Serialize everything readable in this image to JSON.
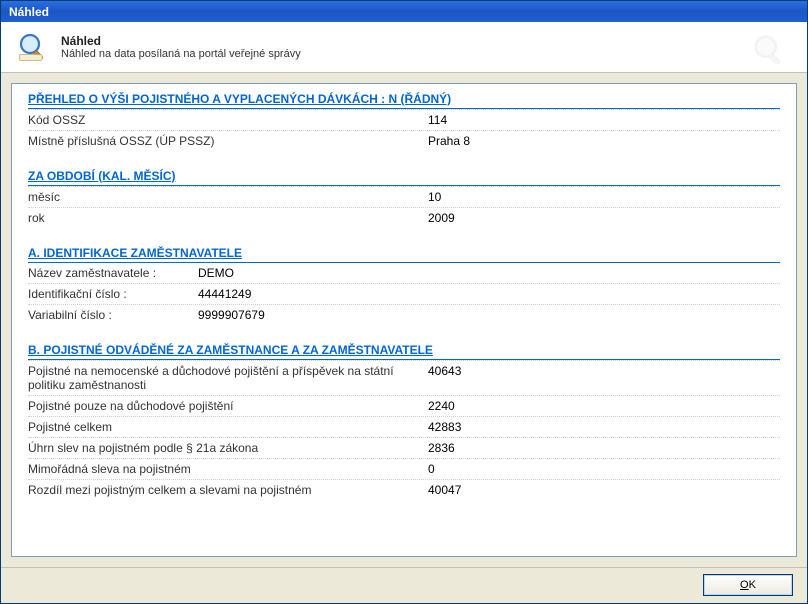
{
  "window": {
    "title": "Náhled"
  },
  "header": {
    "title": "Náhled",
    "subtitle": "Náhled na data posílaná na portál veřejné správy"
  },
  "sections": {
    "overview": {
      "heading": "PŘEHLED O VÝŠI POJISTNÉHO A VYPLACENÝCH DÁVKÁCH : N (ŘÁDNÝ)",
      "rows": [
        {
          "label": "Kód OSSZ",
          "value": "114"
        },
        {
          "label": "Místně příslušná OSSZ (ÚP PSSZ)",
          "value": "Praha 8"
        }
      ]
    },
    "period": {
      "heading": "ZA OBDOBÍ (KAL. MĚSÍC)",
      "rows": [
        {
          "label": "měsíc",
          "value": "10"
        },
        {
          "label": "rok",
          "value": "2009"
        }
      ]
    },
    "employer": {
      "heading": "A. IDENTIFIKACE ZAMĚSTNAVATELE",
      "rows": [
        {
          "label": "Název zaměstnavatele :",
          "value": "DEMO"
        },
        {
          "label": "Identifikační číslo :",
          "value": "44441249"
        },
        {
          "label": "Variabilní číslo :",
          "value": "9999907679"
        }
      ]
    },
    "insurance": {
      "heading": "B. POJISTNÉ ODVÁDĚNÉ ZA ZAMĚSTNANCE A ZA ZAMĚSTNAVATELE",
      "rows": [
        {
          "label": "Pojistné na nemocenské a důchodové pojištění a příspěvek na státní politiku zaměstnanosti",
          "value": "40643"
        },
        {
          "label": "Pojistné pouze na důchodové pojištění",
          "value": "2240"
        },
        {
          "label": "Pojistné celkem",
          "value": "42883"
        },
        {
          "label": "Úhrn slev na pojistném podle § 21a zákona",
          "value": "2836"
        },
        {
          "label": "Mimořádná sleva na pojistném",
          "value": "0"
        },
        {
          "label": "Rozdíl mezi pojistným celkem a slevami na pojistném",
          "value": "40047"
        }
      ]
    }
  },
  "footer": {
    "ok_label": "OK"
  }
}
